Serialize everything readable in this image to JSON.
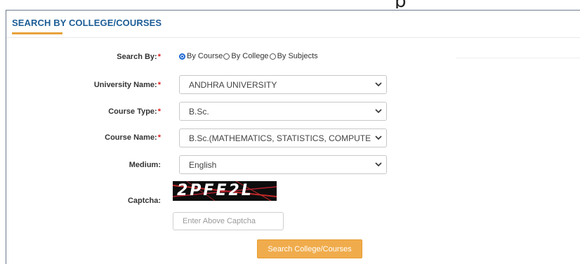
{
  "page": {
    "top_fragment_text": "p"
  },
  "panel": {
    "title": "SEARCH BY COLLEGE/COURSES"
  },
  "form": {
    "search_by": {
      "label": "Search By:",
      "required_mark": "*",
      "options": [
        {
          "label": "By Course",
          "checked": true
        },
        {
          "label": "By College",
          "checked": false
        },
        {
          "label": "By Subjects",
          "checked": false
        }
      ]
    },
    "university": {
      "label": "University Name:",
      "required_mark": "*",
      "value": "ANDHRA UNIVERSITY"
    },
    "course_type": {
      "label": "Course Type:",
      "required_mark": "*",
      "value": "B.Sc."
    },
    "course_name": {
      "label": "Course Name:",
      "required_mark": "*",
      "value": "B.Sc.(MATHEMATICS, STATISTICS, COMPUTER"
    },
    "medium": {
      "label": "Medium:",
      "value": "English"
    },
    "captcha": {
      "label": "Captcha:",
      "image_text": "2PFE2L",
      "input_placeholder": "Enter Above Captcha",
      "input_value": ""
    },
    "submit_label": "Search College/Courses"
  },
  "colors": {
    "title": "#1c5d96",
    "accent_underline": "#e8a33b",
    "button": "#f0ac4c",
    "required": "#e02020",
    "radio_checked": "#1a66d2"
  },
  "icons": {
    "select_arrow": "chevron-down-icon"
  }
}
